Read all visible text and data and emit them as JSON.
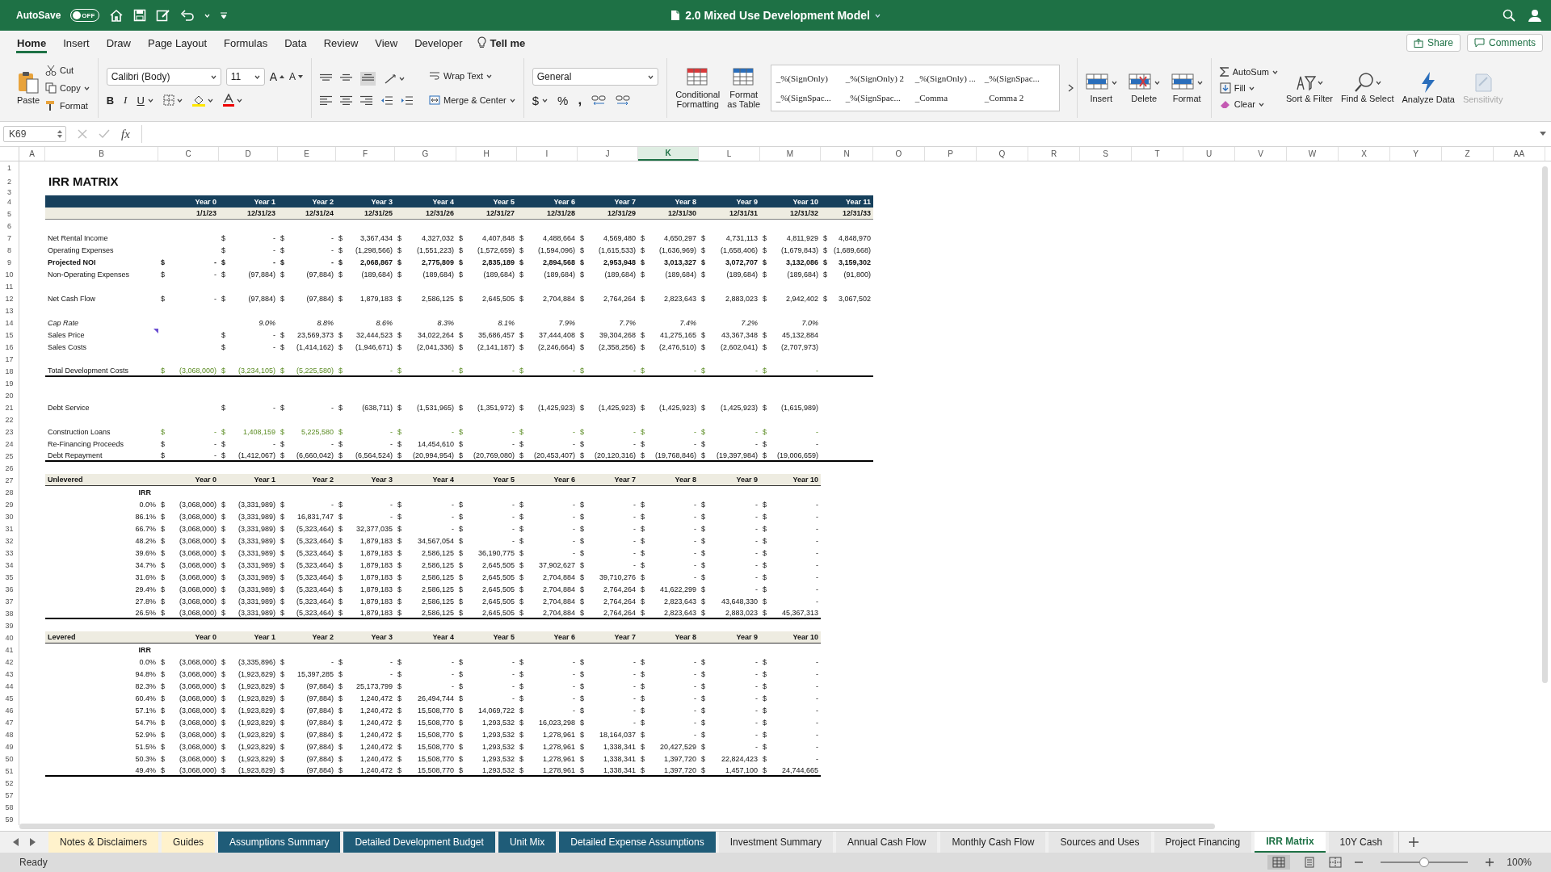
{
  "window": {
    "title": "2.0 Mixed Use Development Model",
    "autosave": {
      "label": "AutoSave",
      "state": "OFF",
      "on": false
    }
  },
  "menu": {
    "tabs": [
      {
        "label": "Home",
        "selected": true
      },
      {
        "label": "Insert",
        "selected": false
      },
      {
        "label": "Draw",
        "selected": false
      },
      {
        "label": "Page Layout",
        "selected": false
      },
      {
        "label": "Formulas",
        "selected": false
      },
      {
        "label": "Data",
        "selected": false
      },
      {
        "label": "Review",
        "selected": false
      },
      {
        "label": "View",
        "selected": false
      },
      {
        "label": "Developer",
        "selected": false
      }
    ],
    "tell_me": "Tell me",
    "share": "Share",
    "comments": "Comments"
  },
  "ribbon": {
    "clipboard": {
      "paste": "Paste",
      "cut": "Cut",
      "copy": "Copy",
      "format": "Format"
    },
    "font": {
      "name": "Calibri (Body)",
      "size": "11",
      "grow": "A",
      "shrink": "A",
      "bold": "B",
      "italic": "I",
      "underline": "U"
    },
    "alignment": {
      "wrap": "Wrap Text",
      "merge": "Merge & Center"
    },
    "number": {
      "format": "General",
      "currency": "$",
      "percent": "%",
      "comma": ","
    },
    "styles": [
      "_%(SignOnly)",
      "_%(SignOnly) 2",
      "_%(SignOnly) ...",
      "_%(SignSpac...",
      "_%(SignSpac...",
      "_%(SignSpac...",
      "_Comma",
      "_Comma 2"
    ],
    "table": [
      "Conditional Formatting",
      "Format as Table"
    ],
    "cells": [
      "Insert",
      "Delete",
      "Format"
    ],
    "editing": {
      "autosum": "AutoSum",
      "fill": "Fill",
      "clear": "Clear",
      "sort": "Sort & Filter",
      "find": "Find & Select"
    },
    "analyze": "Analyze Data",
    "sensitivity": {
      "label": "Sensitivity",
      "disabled": true
    }
  },
  "formula_bar": {
    "name_box": "K69",
    "fx": "fx"
  },
  "columns": [
    {
      "label": "A",
      "selected": false
    },
    {
      "label": "B",
      "selected": false
    },
    {
      "label": "C",
      "selected": false
    },
    {
      "label": "D",
      "selected": false
    },
    {
      "label": "E",
      "selected": false
    },
    {
      "label": "F",
      "selected": false
    },
    {
      "label": "G",
      "selected": false
    },
    {
      "label": "H",
      "selected": false
    },
    {
      "label": "I",
      "selected": false
    },
    {
      "label": "J",
      "selected": false
    },
    {
      "label": "K",
      "selected": true
    },
    {
      "label": "L",
      "selected": false
    },
    {
      "label": "M",
      "selected": false
    },
    {
      "label": "N",
      "selected": false
    },
    {
      "label": "O",
      "selected": false
    },
    {
      "label": "P",
      "selected": false
    },
    {
      "label": "Q",
      "selected": false
    },
    {
      "label": "R",
      "selected": false
    },
    {
      "label": "S",
      "selected": false
    },
    {
      "label": "T",
      "selected": false
    },
    {
      "label": "U",
      "selected": false
    },
    {
      "label": "V",
      "selected": false
    },
    {
      "label": "W",
      "selected": false
    },
    {
      "label": "X",
      "selected": false
    },
    {
      "label": "Y",
      "selected": false
    },
    {
      "label": "Z",
      "selected": false
    },
    {
      "label": "AA",
      "selected": false
    }
  ],
  "sheet": {
    "rows": [
      {
        "n": "1"
      },
      {
        "n": "2",
        "kind": "title",
        "label": "IRR MATRIX"
      },
      {
        "n": "3",
        "kind": "thin"
      },
      {
        "n": "4",
        "kind": "band",
        "cells": [
          "Year 0",
          "Year 1",
          "Year 2",
          "Year 3",
          "Year 4",
          "Year 5",
          "Year 6",
          "Year 7",
          "Year 8",
          "Year 9",
          "Year 10",
          "Year 11"
        ]
      },
      {
        "n": "5",
        "kind": "dates",
        "cells": [
          "1/1/23",
          "12/31/23",
          "12/31/24",
          "12/31/25",
          "12/31/26",
          "12/31/27",
          "12/31/28",
          "12/31/29",
          "12/31/30",
          "12/31/31",
          "12/31/32",
          "12/31/33"
        ]
      },
      {
        "n": "6"
      },
      {
        "n": "7",
        "kind": "data",
        "label": "Net Rental Income",
        "cells": [
          null,
          [
            "$",
            "-"
          ],
          [
            "$",
            "-"
          ],
          [
            "$",
            "3,367,434"
          ],
          [
            "$",
            "4,327,032"
          ],
          [
            "$",
            "4,407,848"
          ],
          [
            "$",
            "4,488,664"
          ],
          [
            "$",
            "4,569,480"
          ],
          [
            "$",
            "4,650,297"
          ],
          [
            "$",
            "4,731,113"
          ],
          [
            "$",
            "4,811,929"
          ],
          [
            "$",
            "4,848,970"
          ]
        ]
      },
      {
        "n": "8",
        "kind": "data",
        "label": "Operating Expenses",
        "cells": [
          null,
          [
            "$",
            "-"
          ],
          [
            "$",
            "-"
          ],
          [
            "$",
            "(1,298,566)"
          ],
          [
            "$",
            "(1,551,223)"
          ],
          [
            "$",
            "(1,572,659)"
          ],
          [
            "$",
            "(1,594,096)"
          ],
          [
            "$",
            "(1,615,533)"
          ],
          [
            "$",
            "(1,636,969)"
          ],
          [
            "$",
            "(1,658,406)"
          ],
          [
            "$",
            "(1,679,843)"
          ],
          [
            "$",
            "(1,689,668)"
          ]
        ]
      },
      {
        "n": "9",
        "kind": "bold",
        "label": "Projected NOI",
        "cells": [
          [
            "$",
            "-"
          ],
          [
            "$",
            "-"
          ],
          [
            "$",
            "-"
          ],
          [
            "$",
            "2,068,867"
          ],
          [
            "$",
            "2,775,809"
          ],
          [
            "$",
            "2,835,189"
          ],
          [
            "$",
            "2,894,568"
          ],
          [
            "$",
            "2,953,948"
          ],
          [
            "$",
            "3,013,327"
          ],
          [
            "$",
            "3,072,707"
          ],
          [
            "$",
            "3,132,086"
          ],
          [
            "$",
            "3,159,302"
          ]
        ]
      },
      {
        "n": "10",
        "kind": "data",
        "label": "Non-Operating Expenses",
        "cells": [
          [
            "$",
            "-"
          ],
          [
            "$",
            "(97,884)"
          ],
          [
            "$",
            "(97,884)"
          ],
          [
            "$",
            "(189,684)"
          ],
          [
            "$",
            "(189,684)"
          ],
          [
            "$",
            "(189,684)"
          ],
          [
            "$",
            "(189,684)"
          ],
          [
            "$",
            "(189,684)"
          ],
          [
            "$",
            "(189,684)"
          ],
          [
            "$",
            "(189,684)"
          ],
          [
            "$",
            "(189,684)"
          ],
          [
            "$",
            "(91,800)"
          ]
        ]
      },
      {
        "n": "11"
      },
      {
        "n": "12",
        "kind": "data",
        "label": "Net Cash Flow",
        "cells": [
          [
            "$",
            "-"
          ],
          [
            "$",
            "(97,884)"
          ],
          [
            "$",
            "(97,884)"
          ],
          [
            "$",
            "1,879,183"
          ],
          [
            "$",
            "2,586,125"
          ],
          [
            "$",
            "2,645,505"
          ],
          [
            "$",
            "2,704,884"
          ],
          [
            "$",
            "2,764,264"
          ],
          [
            "$",
            "2,823,643"
          ],
          [
            "$",
            "2,883,023"
          ],
          [
            "$",
            "2,942,402"
          ],
          [
            "$",
            "3,067,502"
          ]
        ]
      },
      {
        "n": "13"
      },
      {
        "n": "14",
        "kind": "italic",
        "label": "Cap Rate",
        "cells": [
          null,
          "9.0%",
          "8.8%",
          "8.6%",
          "8.3%",
          "8.1%",
          "7.9%",
          "7.7%",
          "7.4%",
          "7.2%",
          "7.0%"
        ]
      },
      {
        "n": "15",
        "kind": "noted",
        "label": "Sales Price",
        "cells": [
          null,
          [
            "$",
            "-"
          ],
          [
            "$",
            "23,569,373"
          ],
          [
            "$",
            "32,444,523"
          ],
          [
            "$",
            "34,022,264"
          ],
          [
            "$",
            "35,686,457"
          ],
          [
            "$",
            "37,444,408"
          ],
          [
            "$",
            "39,304,268"
          ],
          [
            "$",
            "41,275,165"
          ],
          [
            "$",
            "43,367,348"
          ],
          [
            "$",
            "45,132,884"
          ]
        ]
      },
      {
        "n": "16",
        "kind": "data",
        "label": "Sales Costs",
        "cells": [
          null,
          [
            "$",
            "-"
          ],
          [
            "$",
            "(1,414,162)"
          ],
          [
            "$",
            "(1,946,671)"
          ],
          [
            "$",
            "(2,041,336)"
          ],
          [
            "$",
            "(2,141,187)"
          ],
          [
            "$",
            "(2,246,664)"
          ],
          [
            "$",
            "(2,358,256)"
          ],
          [
            "$",
            "(2,476,510)"
          ],
          [
            "$",
            "(2,602,041)"
          ],
          [
            "$",
            "(2,707,973)"
          ]
        ]
      },
      {
        "n": "17"
      },
      {
        "n": "18",
        "kind": "green_total",
        "label": "Total Development Costs",
        "cells": [
          [
            "$",
            "(3,068,000)"
          ],
          [
            "$",
            "(3,234,105)"
          ],
          [
            "$",
            "(5,225,580)"
          ],
          [
            "$",
            "-"
          ],
          [
            "$",
            "-"
          ],
          [
            "$",
            "-"
          ],
          [
            "$",
            "-"
          ],
          [
            "$",
            "-"
          ],
          [
            "$",
            "-"
          ],
          [
            "$",
            "-"
          ],
          [
            "$",
            "-"
          ],
          null
        ]
      },
      {
        "n": "19"
      },
      {
        "n": "20"
      },
      {
        "n": "21",
        "kind": "data",
        "label": "Debt Service",
        "cells": [
          null,
          [
            "$",
            "-"
          ],
          [
            "$",
            "-"
          ],
          [
            "$",
            "(638,711)"
          ],
          [
            "$",
            "(1,531,965)"
          ],
          [
            "$",
            "(1,351,972)"
          ],
          [
            "$",
            "(1,425,923)"
          ],
          [
            "$",
            "(1,425,923)"
          ],
          [
            "$",
            "(1,425,923)"
          ],
          [
            "$",
            "(1,425,923)"
          ],
          [
            "$",
            "(1,615,989)"
          ]
        ]
      },
      {
        "n": "22"
      },
      {
        "n": "23",
        "kind": "green",
        "label": "Construction Loans",
        "cells": [
          [
            "$",
            "-"
          ],
          [
            "$",
            "1,408,159"
          ],
          [
            "$",
            "5,225,580"
          ],
          [
            "$",
            "-"
          ],
          [
            "$",
            "-"
          ],
          [
            "$",
            "-"
          ],
          [
            "$",
            "-"
          ],
          [
            "$",
            "-"
          ],
          [
            "$",
            "-"
          ],
          [
            "$",
            "-"
          ],
          [
            "$",
            "-"
          ]
        ]
      },
      {
        "n": "24",
        "kind": "data",
        "label": "Re-Financing Proceeds",
        "cells": [
          [
            "$",
            "-"
          ],
          [
            "$",
            "-"
          ],
          [
            "$",
            "-"
          ],
          [
            "$",
            "-"
          ],
          [
            "$",
            "14,454,610"
          ],
          [
            "$",
            "-"
          ],
          [
            "$",
            "-"
          ],
          [
            "$",
            "-"
          ],
          [
            "$",
            "-"
          ],
          [
            "$",
            "-"
          ],
          [
            "$",
            "-"
          ]
        ]
      },
      {
        "n": "25",
        "kind": "total",
        "label": "Debt Repayment",
        "cells": [
          [
            "$",
            "-"
          ],
          [
            "$",
            "(1,412,067)"
          ],
          [
            "$",
            "(6,660,042)"
          ],
          [
            "$",
            "(6,564,524)"
          ],
          [
            "$",
            "(20,994,954)"
          ],
          [
            "$",
            "(20,769,080)"
          ],
          [
            "$",
            "(20,453,407)"
          ],
          [
            "$",
            "(20,120,316)"
          ],
          [
            "$",
            "(19,768,846)"
          ],
          [
            "$",
            "(19,397,984)"
          ],
          [
            "$",
            "(19,006,659)"
          ],
          null
        ]
      },
      {
        "n": "26"
      },
      {
        "n": "27",
        "kind": "section",
        "label": "Unlevered",
        "cells": [
          "Year 0",
          "Year 1",
          "Year 2",
          "Year 3",
          "Year 4",
          "Year 5",
          "Year 6",
          "Year 7",
          "Year 8",
          "Year 9",
          "Year 10"
        ]
      },
      {
        "n": "28",
        "kind": "irr_head",
        "label": "IRR"
      },
      {
        "n": "29",
        "kind": "matrix",
        "label": "0.0%",
        "cells": [
          [
            "$",
            "(3,068,000)"
          ],
          [
            "$",
            "(3,331,989)"
          ],
          [
            "$",
            "-"
          ],
          [
            "$",
            "-"
          ],
          [
            "$",
            "-"
          ],
          [
            "$",
            "-"
          ],
          [
            "$",
            "-"
          ],
          [
            "$",
            "-"
          ],
          [
            "$",
            "-"
          ],
          [
            "$",
            "-"
          ],
          [
            "$",
            "-"
          ]
        ]
      },
      {
        "n": "30",
        "kind": "matrix",
        "label": "86.1%",
        "cells": [
          [
            "$",
            "(3,068,000)"
          ],
          [
            "$",
            "(3,331,989)"
          ],
          [
            "$",
            "16,831,747"
          ],
          [
            "$",
            "-"
          ],
          [
            "$",
            "-"
          ],
          [
            "$",
            "-"
          ],
          [
            "$",
            "-"
          ],
          [
            "$",
            "-"
          ],
          [
            "$",
            "-"
          ],
          [
            "$",
            "-"
          ],
          [
            "$",
            "-"
          ]
        ]
      },
      {
        "n": "31",
        "kind": "matrix",
        "label": "66.7%",
        "cells": [
          [
            "$",
            "(3,068,000)"
          ],
          [
            "$",
            "(3,331,989)"
          ],
          [
            "$",
            "(5,323,464)"
          ],
          [
            "$",
            "32,377,035"
          ],
          [
            "$",
            "-"
          ],
          [
            "$",
            "-"
          ],
          [
            "$",
            "-"
          ],
          [
            "$",
            "-"
          ],
          [
            "$",
            "-"
          ],
          [
            "$",
            "-"
          ],
          [
            "$",
            "-"
          ]
        ]
      },
      {
        "n": "32",
        "kind": "matrix",
        "label": "48.2%",
        "cells": [
          [
            "$",
            "(3,068,000)"
          ],
          [
            "$",
            "(3,331,989)"
          ],
          [
            "$",
            "(5,323,464)"
          ],
          [
            "$",
            "1,879,183"
          ],
          [
            "$",
            "34,567,054"
          ],
          [
            "$",
            "-"
          ],
          [
            "$",
            "-"
          ],
          [
            "$",
            "-"
          ],
          [
            "$",
            "-"
          ],
          [
            "$",
            "-"
          ],
          [
            "$",
            "-"
          ]
        ]
      },
      {
        "n": "33",
        "kind": "matrix",
        "label": "39.6%",
        "cells": [
          [
            "$",
            "(3,068,000)"
          ],
          [
            "$",
            "(3,331,989)"
          ],
          [
            "$",
            "(5,323,464)"
          ],
          [
            "$",
            "1,879,183"
          ],
          [
            "$",
            "2,586,125"
          ],
          [
            "$",
            "36,190,775"
          ],
          [
            "$",
            "-"
          ],
          [
            "$",
            "-"
          ],
          [
            "$",
            "-"
          ],
          [
            "$",
            "-"
          ],
          [
            "$",
            "-"
          ]
        ]
      },
      {
        "n": "34",
        "kind": "matrix",
        "label": "34.7%",
        "cells": [
          [
            "$",
            "(3,068,000)"
          ],
          [
            "$",
            "(3,331,989)"
          ],
          [
            "$",
            "(5,323,464)"
          ],
          [
            "$",
            "1,879,183"
          ],
          [
            "$",
            "2,586,125"
          ],
          [
            "$",
            "2,645,505"
          ],
          [
            "$",
            "37,902,627"
          ],
          [
            "$",
            "-"
          ],
          [
            "$",
            "-"
          ],
          [
            "$",
            "-"
          ],
          [
            "$",
            "-"
          ]
        ]
      },
      {
        "n": "35",
        "kind": "matrix",
        "label": "31.6%",
        "cells": [
          [
            "$",
            "(3,068,000)"
          ],
          [
            "$",
            "(3,331,989)"
          ],
          [
            "$",
            "(5,323,464)"
          ],
          [
            "$",
            "1,879,183"
          ],
          [
            "$",
            "2,586,125"
          ],
          [
            "$",
            "2,645,505"
          ],
          [
            "$",
            "2,704,884"
          ],
          [
            "$",
            "39,710,276"
          ],
          [
            "$",
            "-"
          ],
          [
            "$",
            "-"
          ],
          [
            "$",
            "-"
          ]
        ]
      },
      {
        "n": "36",
        "kind": "matrix",
        "label": "29.4%",
        "cells": [
          [
            "$",
            "(3,068,000)"
          ],
          [
            "$",
            "(3,331,989)"
          ],
          [
            "$",
            "(5,323,464)"
          ],
          [
            "$",
            "1,879,183"
          ],
          [
            "$",
            "2,586,125"
          ],
          [
            "$",
            "2,645,505"
          ],
          [
            "$",
            "2,704,884"
          ],
          [
            "$",
            "2,764,264"
          ],
          [
            "$",
            "41,622,299"
          ],
          [
            "$",
            "-"
          ],
          [
            "$",
            "-"
          ]
        ]
      },
      {
        "n": "37",
        "kind": "matrix",
        "label": "27.8%",
        "cells": [
          [
            "$",
            "(3,068,000)"
          ],
          [
            "$",
            "(3,331,989)"
          ],
          [
            "$",
            "(5,323,464)"
          ],
          [
            "$",
            "1,879,183"
          ],
          [
            "$",
            "2,586,125"
          ],
          [
            "$",
            "2,645,505"
          ],
          [
            "$",
            "2,704,884"
          ],
          [
            "$",
            "2,764,264"
          ],
          [
            "$",
            "2,823,643"
          ],
          [
            "$",
            "43,648,330"
          ],
          [
            "$",
            "-"
          ]
        ]
      },
      {
        "n": "38",
        "kind": "matrix_total",
        "label": "26.5%",
        "cells": [
          [
            "$",
            "(3,068,000)"
          ],
          [
            "$",
            "(3,331,989)"
          ],
          [
            "$",
            "(5,323,464)"
          ],
          [
            "$",
            "1,879,183"
          ],
          [
            "$",
            "2,586,125"
          ],
          [
            "$",
            "2,645,505"
          ],
          [
            "$",
            "2,704,884"
          ],
          [
            "$",
            "2,764,264"
          ],
          [
            "$",
            "2,823,643"
          ],
          [
            "$",
            "2,883,023"
          ],
          [
            "$",
            "45,367,313"
          ]
        ]
      },
      {
        "n": "39"
      },
      {
        "n": "40",
        "kind": "section",
        "label": "Levered",
        "cells": [
          "Year 0",
          "Year 1",
          "Year 2",
          "Year 3",
          "Year 4",
          "Year 5",
          "Year 6",
          "Year 7",
          "Year 8",
          "Year 9",
          "Year 10"
        ]
      },
      {
        "n": "41",
        "kind": "irr_head",
        "label": "IRR"
      },
      {
        "n": "42",
        "kind": "matrix",
        "label": "0.0%",
        "cells": [
          [
            "$",
            "(3,068,000)"
          ],
          [
            "$",
            "(3,335,896)"
          ],
          [
            "$",
            "-"
          ],
          [
            "$",
            "-"
          ],
          [
            "$",
            "-"
          ],
          [
            "$",
            "-"
          ],
          [
            "$",
            "-"
          ],
          [
            "$",
            "-"
          ],
          [
            "$",
            "-"
          ],
          [
            "$",
            "-"
          ],
          [
            "$",
            "-"
          ]
        ]
      },
      {
        "n": "43",
        "kind": "matrix",
        "label": "94.8%",
        "cells": [
          [
            "$",
            "(3,068,000)"
          ],
          [
            "$",
            "(1,923,829)"
          ],
          [
            "$",
            "15,397,285"
          ],
          [
            "$",
            "-"
          ],
          [
            "$",
            "-"
          ],
          [
            "$",
            "-"
          ],
          [
            "$",
            "-"
          ],
          [
            "$",
            "-"
          ],
          [
            "$",
            "-"
          ],
          [
            "$",
            "-"
          ],
          [
            "$",
            "-"
          ]
        ]
      },
      {
        "n": "44",
        "kind": "matrix",
        "label": "82.3%",
        "cells": [
          [
            "$",
            "(3,068,000)"
          ],
          [
            "$",
            "(1,923,829)"
          ],
          [
            "$",
            "(97,884)"
          ],
          [
            "$",
            "25,173,799"
          ],
          [
            "$",
            "-"
          ],
          [
            "$",
            "-"
          ],
          [
            "$",
            "-"
          ],
          [
            "$",
            "-"
          ],
          [
            "$",
            "-"
          ],
          [
            "$",
            "-"
          ],
          [
            "$",
            "-"
          ]
        ]
      },
      {
        "n": "45",
        "kind": "matrix",
        "label": "60.4%",
        "cells": [
          [
            "$",
            "(3,068,000)"
          ],
          [
            "$",
            "(1,923,829)"
          ],
          [
            "$",
            "(97,884)"
          ],
          [
            "$",
            "1,240,472"
          ],
          [
            "$",
            "26,494,744"
          ],
          [
            "$",
            "-"
          ],
          [
            "$",
            "-"
          ],
          [
            "$",
            "-"
          ],
          [
            "$",
            "-"
          ],
          [
            "$",
            "-"
          ],
          [
            "$",
            "-"
          ]
        ]
      },
      {
        "n": "46",
        "kind": "matrix",
        "label": "57.1%",
        "cells": [
          [
            "$",
            "(3,068,000)"
          ],
          [
            "$",
            "(1,923,829)"
          ],
          [
            "$",
            "(97,884)"
          ],
          [
            "$",
            "1,240,472"
          ],
          [
            "$",
            "15,508,770"
          ],
          [
            "$",
            "14,069,722"
          ],
          [
            "$",
            "-"
          ],
          [
            "$",
            "-"
          ],
          [
            "$",
            "-"
          ],
          [
            "$",
            "-"
          ],
          [
            "$",
            "-"
          ]
        ]
      },
      {
        "n": "47",
        "kind": "matrix",
        "label": "54.7%",
        "cells": [
          [
            "$",
            "(3,068,000)"
          ],
          [
            "$",
            "(1,923,829)"
          ],
          [
            "$",
            "(97,884)"
          ],
          [
            "$",
            "1,240,472"
          ],
          [
            "$",
            "15,508,770"
          ],
          [
            "$",
            "1,293,532"
          ],
          [
            "$",
            "16,023,298"
          ],
          [
            "$",
            "-"
          ],
          [
            "$",
            "-"
          ],
          [
            "$",
            "-"
          ],
          [
            "$",
            "-"
          ]
        ]
      },
      {
        "n": "48",
        "kind": "matrix",
        "label": "52.9%",
        "cells": [
          [
            "$",
            "(3,068,000)"
          ],
          [
            "$",
            "(1,923,829)"
          ],
          [
            "$",
            "(97,884)"
          ],
          [
            "$",
            "1,240,472"
          ],
          [
            "$",
            "15,508,770"
          ],
          [
            "$",
            "1,293,532"
          ],
          [
            "$",
            "1,278,961"
          ],
          [
            "$",
            "18,164,037"
          ],
          [
            "$",
            "-"
          ],
          [
            "$",
            "-"
          ],
          [
            "$",
            "-"
          ]
        ]
      },
      {
        "n": "49",
        "kind": "matrix",
        "label": "51.5%",
        "cells": [
          [
            "$",
            "(3,068,000)"
          ],
          [
            "$",
            "(1,923,829)"
          ],
          [
            "$",
            "(97,884)"
          ],
          [
            "$",
            "1,240,472"
          ],
          [
            "$",
            "15,508,770"
          ],
          [
            "$",
            "1,293,532"
          ],
          [
            "$",
            "1,278,961"
          ],
          [
            "$",
            "1,338,341"
          ],
          [
            "$",
            "20,427,529"
          ],
          [
            "$",
            "-"
          ],
          [
            "$",
            "-"
          ]
        ]
      },
      {
        "n": "50",
        "kind": "matrix",
        "label": "50.3%",
        "cells": [
          [
            "$",
            "(3,068,000)"
          ],
          [
            "$",
            "(1,923,829)"
          ],
          [
            "$",
            "(97,884)"
          ],
          [
            "$",
            "1,240,472"
          ],
          [
            "$",
            "15,508,770"
          ],
          [
            "$",
            "1,293,532"
          ],
          [
            "$",
            "1,278,961"
          ],
          [
            "$",
            "1,338,341"
          ],
          [
            "$",
            "1,397,720"
          ],
          [
            "$",
            "22,824,423"
          ],
          [
            "$",
            "-"
          ]
        ]
      },
      {
        "n": "51",
        "kind": "matrix_total",
        "label": "49.4%",
        "cells": [
          [
            "$",
            "(3,068,000)"
          ],
          [
            "$",
            "(1,923,829)"
          ],
          [
            "$",
            "(97,884)"
          ],
          [
            "$",
            "1,240,472"
          ],
          [
            "$",
            "15,508,770"
          ],
          [
            "$",
            "1,293,532"
          ],
          [
            "$",
            "1,278,961"
          ],
          [
            "$",
            "1,338,341"
          ],
          [
            "$",
            "1,397,720"
          ],
          [
            "$",
            "1,457,100"
          ],
          [
            "$",
            "24,744,665"
          ]
        ]
      },
      {
        "n": "52"
      },
      {
        "n": "57"
      },
      {
        "n": "58"
      },
      {
        "n": "59"
      }
    ]
  },
  "sheet_tabs": [
    {
      "label": "Notes & Disclaimers",
      "color": "#fff2cc",
      "selected": false
    },
    {
      "label": "Guides",
      "color": "#fff2cc",
      "selected": false
    },
    {
      "label": "Assumptions Summary",
      "color": "#1f5c78",
      "selected": false
    },
    {
      "label": "Detailed Development Budget",
      "color": "#1f5c78",
      "selected": false
    },
    {
      "label": "Unit Mix",
      "color": "#1f5c78",
      "selected": false
    },
    {
      "label": "Detailed Expense Assumptions",
      "color": "#1f5c78",
      "selected": false
    },
    {
      "label": "Investment Summary",
      "color": "#e6e6e6",
      "selected": false
    },
    {
      "label": "Annual Cash Flow",
      "color": "#e6e6e6",
      "selected": false
    },
    {
      "label": "Monthly Cash Flow",
      "color": "#e6e6e6",
      "selected": false
    },
    {
      "label": "Sources and Uses",
      "color": "#e6e6e6",
      "selected": false
    },
    {
      "label": "Project Financing",
      "color": "#e6e6e6",
      "selected": false
    },
    {
      "label": "IRR Matrix",
      "color": "#ffffff",
      "selected": true
    },
    {
      "label": "10Y Cash",
      "color": "#e6e6e6",
      "selected": false
    }
  ],
  "status_bar": {
    "status": "Ready",
    "zoom": "100%",
    "zoom_slider": {
      "level": 0.5
    }
  }
}
